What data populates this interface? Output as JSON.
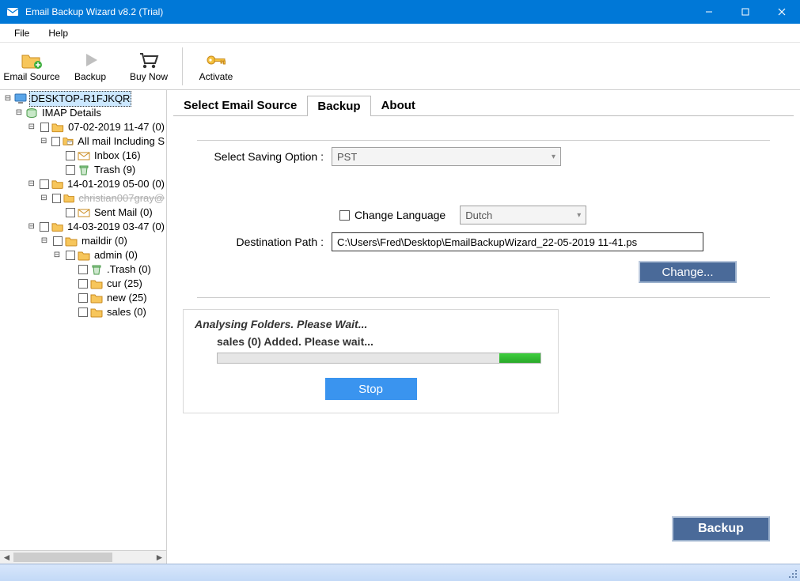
{
  "window": {
    "title": "Email Backup Wizard v8.2 (Trial)"
  },
  "menu": {
    "file": "File",
    "help": "Help"
  },
  "toolbar": {
    "email_source": "Email Source",
    "backup": "Backup",
    "buy_now": "Buy Now",
    "activate": "Activate"
  },
  "tree": {
    "root": "DESKTOP-R1FJKQR",
    "imap": "IMAP Details",
    "n1": "07-02-2019 11-47 (0)",
    "n1a": "All mail Including S",
    "n1b": "Inbox (16)",
    "n1c": "Trash (9)",
    "n2": "14-01-2019 05-00 (0)",
    "n2a": "christian007gray@",
    "n2b": "Sent Mail (0)",
    "n3": "14-03-2019 03-47 (0)",
    "n3a": "maildir (0)",
    "n3b": "admin (0)",
    "n3c": ".Trash (0)",
    "n3d": "cur (25)",
    "n3e": "new (25)",
    "n3f": "sales (0)"
  },
  "tabs": {
    "select": "Select Email Source",
    "backup": "Backup",
    "about": "About"
  },
  "form": {
    "saving_label": "Select Saving Option :",
    "saving_value": "PST",
    "change_lang_label": "Change Language",
    "lang_value": "Dutch",
    "dest_label": "Destination Path :",
    "dest_value": "C:\\Users\\Fred\\Desktop\\EmailBackupWizard_22-05-2019 11-41.ps",
    "change_btn": "Change...",
    "backup_btn": "Backup"
  },
  "progress": {
    "title": "Analysing Folders. Please Wait...",
    "status": "sales (0) Added. Please wait...",
    "stop": "Stop"
  }
}
